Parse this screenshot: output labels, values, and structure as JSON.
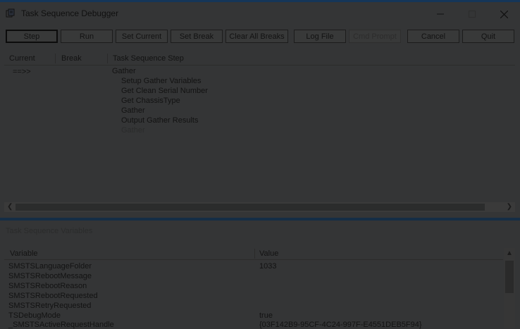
{
  "window": {
    "title": "Task Sequence Debugger"
  },
  "toolbar": {
    "buttons": [
      {
        "label": "Step"
      },
      {
        "label": "Run"
      },
      {
        "label": "Set Current"
      },
      {
        "label": "Set Break"
      },
      {
        "label": "Clear All Breaks"
      },
      {
        "label": "Log File"
      },
      {
        "label": "Cmd Prompt"
      },
      {
        "label": "Cancel"
      },
      {
        "label": "Quit"
      }
    ]
  },
  "steps": {
    "headers": {
      "current": "Current",
      "break": "Break",
      "step": "Task Sequence Step"
    },
    "current_marker": "==>>",
    "rows": [
      {
        "name": "Gather"
      },
      {
        "name": "Setup Gather Variables"
      },
      {
        "name": "Get Clean Serial Number"
      },
      {
        "name": "Get ChassisType"
      },
      {
        "name": "Gather"
      },
      {
        "name": "Output Gather Results"
      },
      {
        "name": "Gather"
      }
    ]
  },
  "variables": {
    "title": "Task Sequence Variables",
    "headers": {
      "variable": "Variable",
      "value": "Value"
    },
    "rows": [
      {
        "name": "SMSTSLanguageFolder",
        "value": "1033"
      },
      {
        "name": "SMSTSRebootMessage",
        "value": ""
      },
      {
        "name": "SMSTSRebootReason",
        "value": ""
      },
      {
        "name": "SMSTSRebootRequested",
        "value": ""
      },
      {
        "name": "SMSTSRetryRequested",
        "value": ""
      },
      {
        "name": "TSDebugMode",
        "value": "true"
      },
      {
        "name": "_SMSTSActiveRequestHandle",
        "value": "{03F142B9-95CF-4C24-997F-E4551DEB5F94}"
      }
    ]
  },
  "colors": {
    "background": "#343536",
    "accent": "#153659"
  }
}
